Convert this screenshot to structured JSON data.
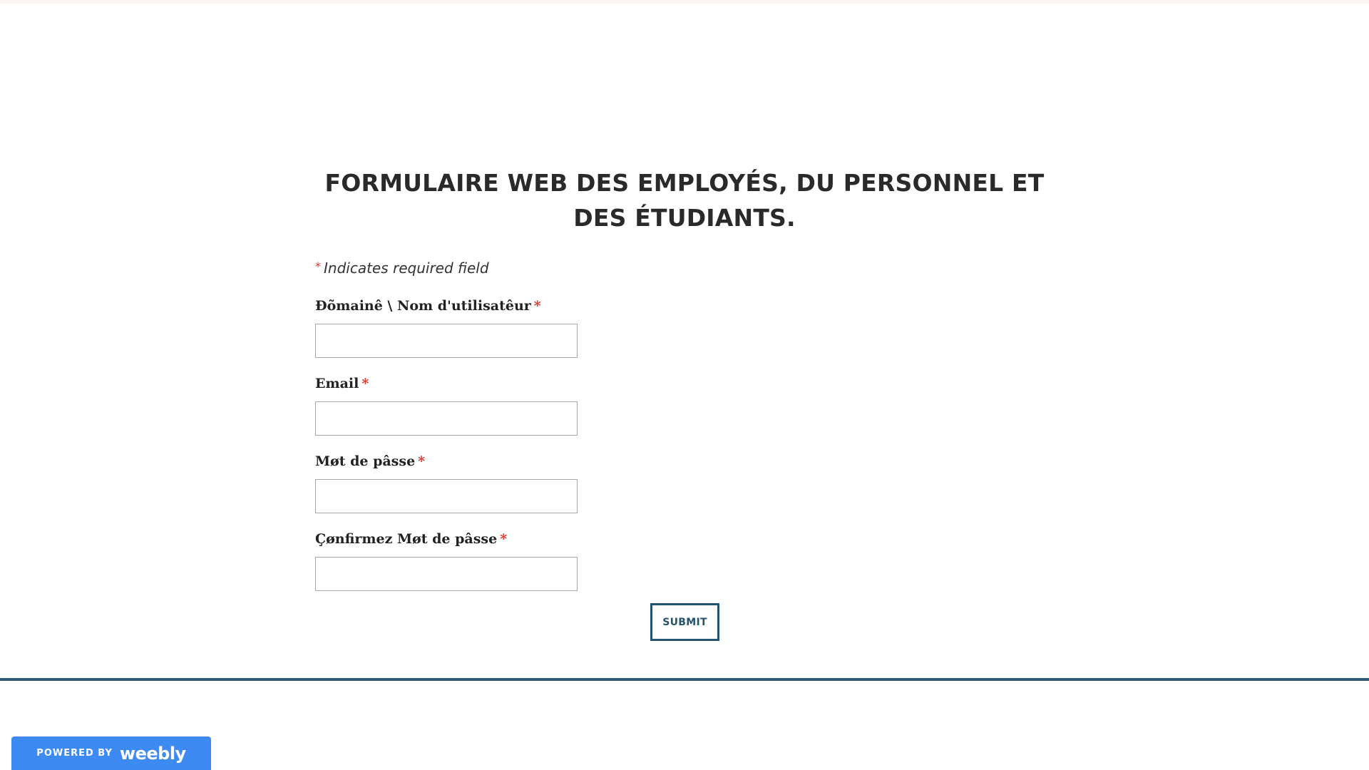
{
  "form": {
    "title": "FORMULAIRE WEB DES EMPLOYÉS, DU PERSONNEL ET DES ÉTUDIANTS.",
    "required_note_star": "*",
    "required_note_text": "Indicates required field",
    "fields": [
      {
        "label": "Ðõmainê \\ Nom d'utilisatêur",
        "required_mark": "*",
        "value": ""
      },
      {
        "label": "Email",
        "required_mark": "*",
        "value": ""
      },
      {
        "label": "Møt de pâsse",
        "required_mark": "*",
        "value": ""
      },
      {
        "label": "Çønfirmez Møt de pâsse",
        "required_mark": "*",
        "value": ""
      }
    ],
    "submit_label": "SUBMIT"
  },
  "footer": {
    "badge_powered": "POWERED BY",
    "badge_brand": "weebly"
  },
  "colors": {
    "accent": "#23536e",
    "required": "#e0312d",
    "badge": "#3d8bf2",
    "rule": "#2f5c78"
  }
}
